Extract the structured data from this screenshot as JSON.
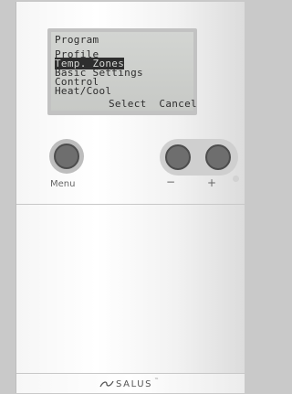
{
  "lcd": {
    "title": "Program",
    "menu": [
      {
        "label": "Profile",
        "selected": false
      },
      {
        "label": "Temp. Zones",
        "selected": true
      },
      {
        "label": "Basic Settings",
        "selected": false
      },
      {
        "label": "Control",
        "selected": false
      },
      {
        "label": "Heat/Cool",
        "selected": false
      }
    ],
    "softkey_left": "Select",
    "softkey_right": "Cancel"
  },
  "buttons": {
    "menu_label": "Menu",
    "minus_label": "−",
    "plus_label": "+"
  },
  "brand": {
    "logo_text": "SALUS",
    "logo_mark": "Ꞩ"
  }
}
